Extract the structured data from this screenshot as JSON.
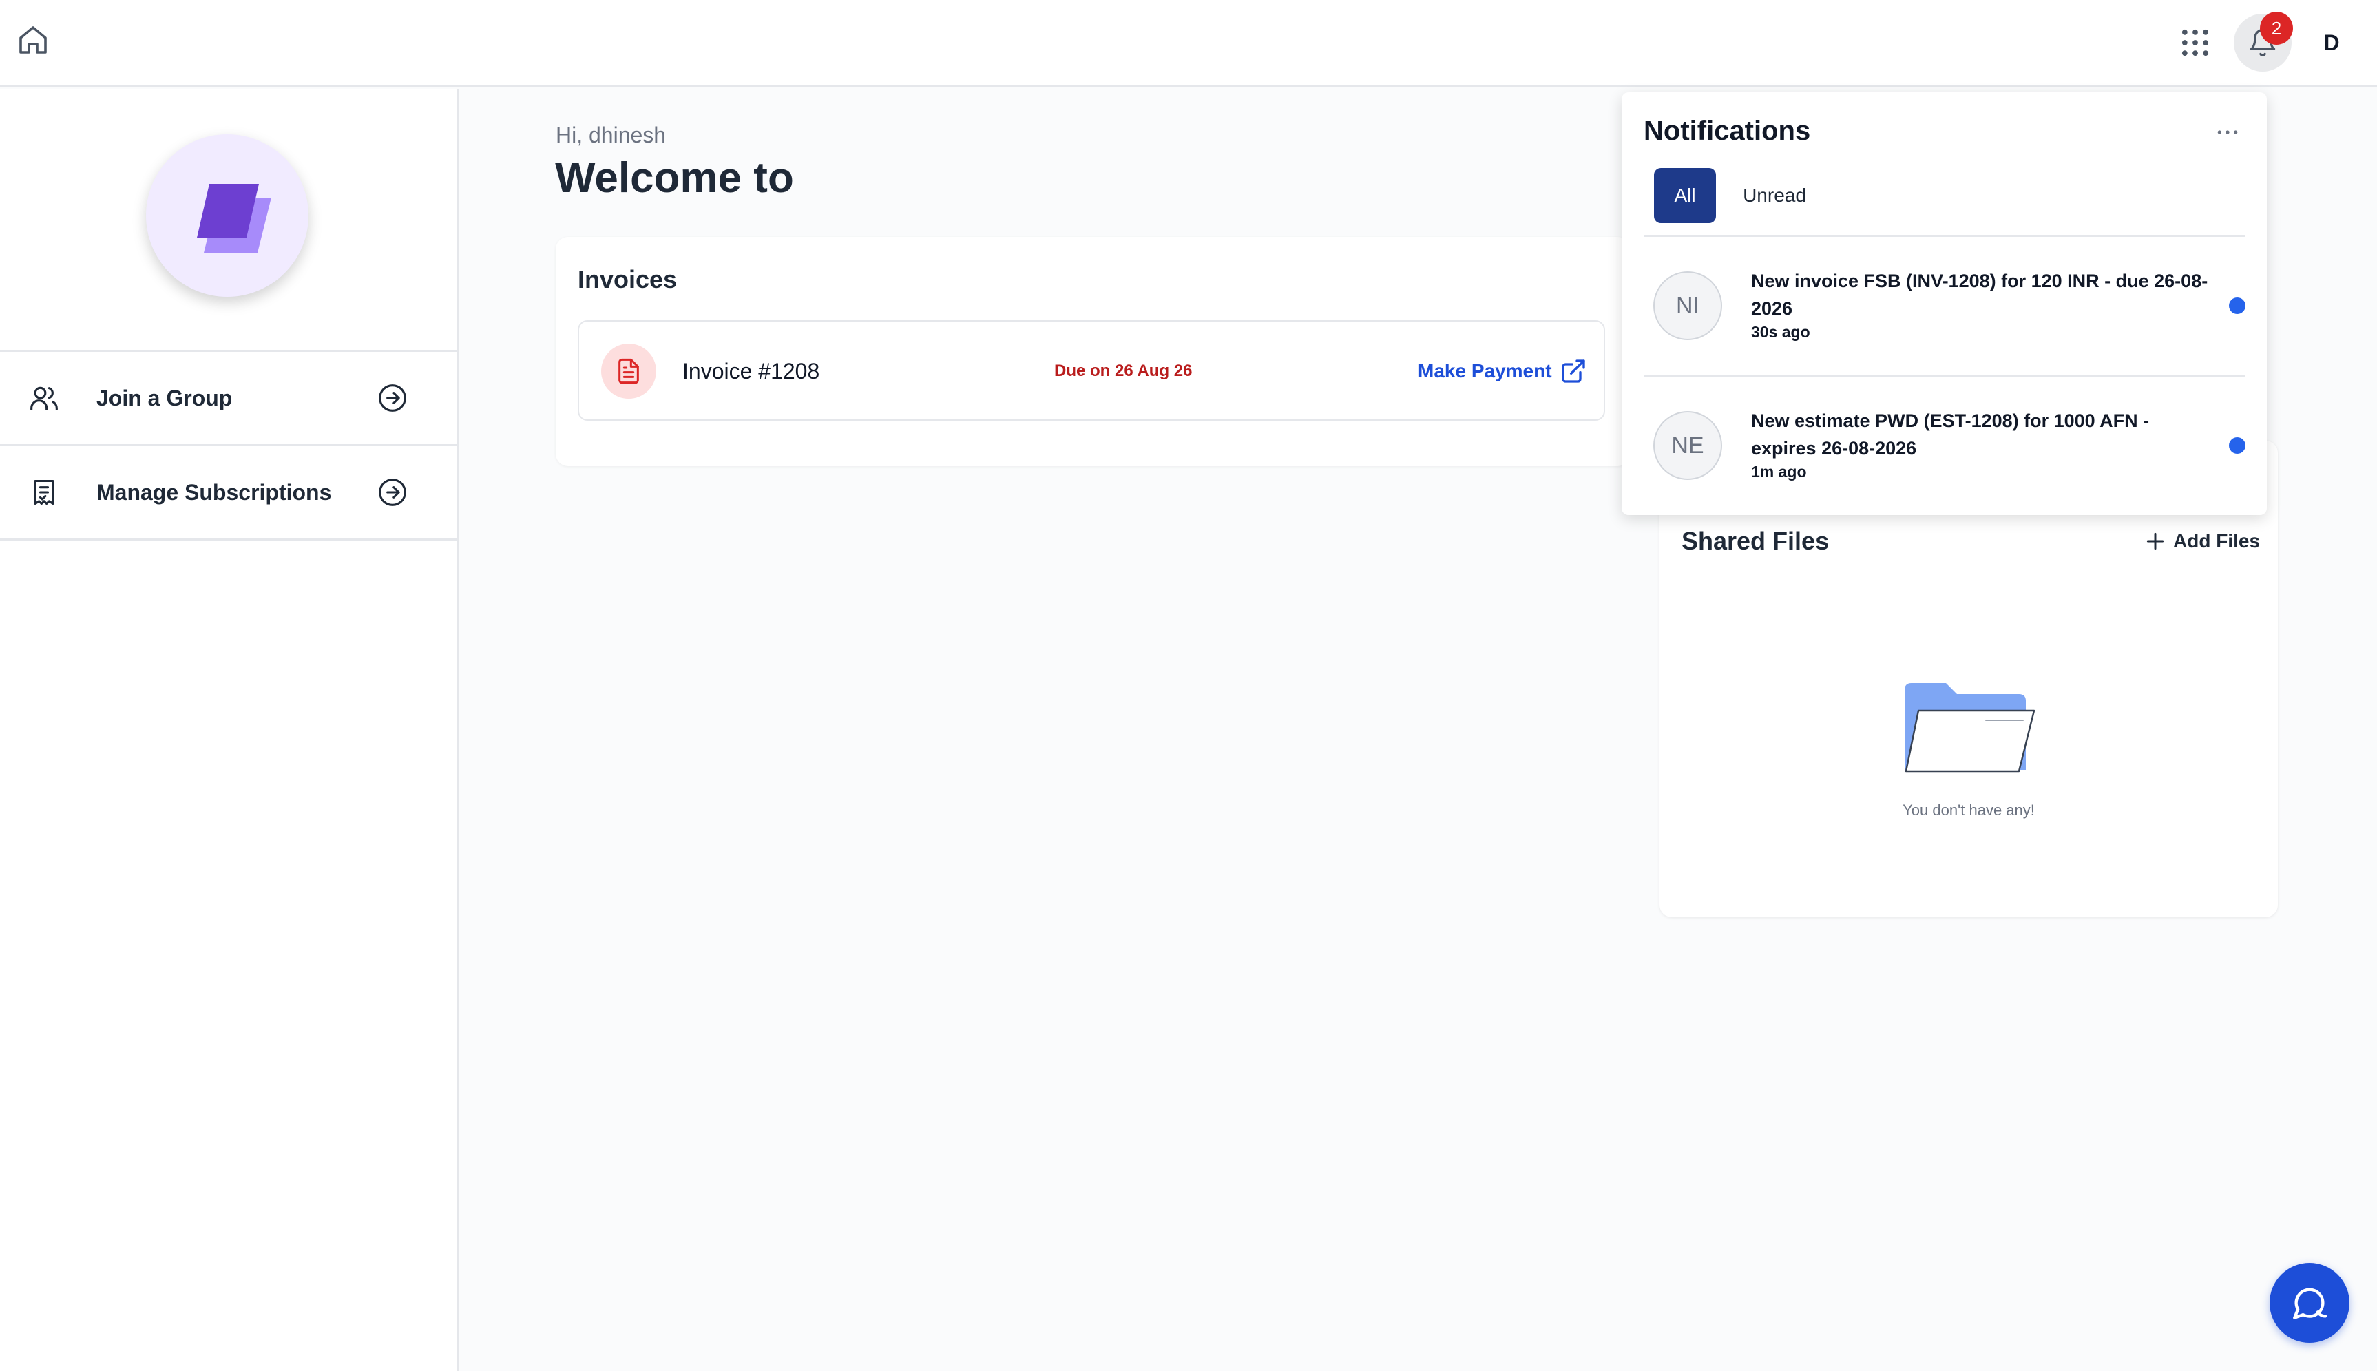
{
  "topbar": {
    "notification_count": "2",
    "user_initial": "D"
  },
  "sidebar": {
    "items": [
      {
        "label": "Join a Group"
      },
      {
        "label": "Manage Subscriptions"
      }
    ]
  },
  "main": {
    "greeting": "Hi, dhinesh",
    "welcome": "Welcome to",
    "invoices": {
      "title": "Invoices",
      "rows": [
        {
          "number": "Invoice #1208",
          "due": "Due on 26 Aug 26",
          "action": "Make Payment"
        }
      ]
    },
    "shared_files": {
      "title": "Shared Files",
      "add_label": "Add Files",
      "empty_text": "You don't have any!"
    }
  },
  "notifications": {
    "title": "Notifications",
    "tabs": [
      {
        "label": "All",
        "active": true
      },
      {
        "label": "Unread",
        "active": false
      }
    ],
    "items": [
      {
        "initials": "NI",
        "text": "New invoice FSB (INV-1208) for 120 INR - due 26-08-2026",
        "time": "30s ago",
        "unread": true
      },
      {
        "initials": "NE",
        "text": "New estimate PWD (EST-1208) for 1000 AFN - expires 26-08-2026",
        "time": "1m ago",
        "unread": true
      }
    ]
  },
  "colors": {
    "primary": "#1d4ed8",
    "active_tab": "#1e3a8a",
    "badge": "#dc2626",
    "due_text": "#b91c1c",
    "unread_dot": "#2563eb",
    "logo_purple": "#7c4ddb"
  },
  "icons": {
    "home": "home-icon",
    "apps": "grid-icon",
    "bell": "bell-icon",
    "join_group": "users-icon",
    "subscriptions": "receipt-icon",
    "arrow": "arrow-circle-right-icon",
    "invoice": "document-icon",
    "external": "external-link-icon",
    "add": "plus-icon",
    "folder": "folder-icon",
    "more": "more-horizontal-icon",
    "chat": "chat-icon"
  }
}
